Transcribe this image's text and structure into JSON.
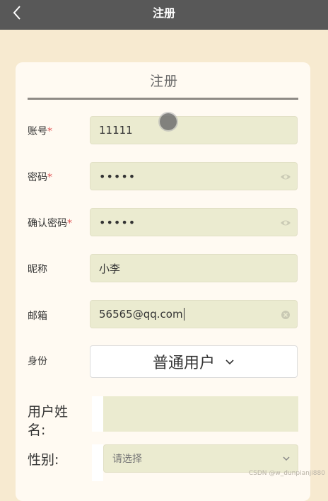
{
  "navbar": {
    "title": "注册"
  },
  "card": {
    "title": "注册"
  },
  "form": {
    "account": {
      "label": "账号",
      "required": "*",
      "value": "11111"
    },
    "password": {
      "label": "密码",
      "required": "*",
      "value": "•••••"
    },
    "confirm_password": {
      "label": "确认密码",
      "required": "*",
      "value": "•••••"
    },
    "nickname": {
      "label": "昵称",
      "value": "小李"
    },
    "email": {
      "label": "邮箱",
      "value": "56565@qq.com"
    },
    "role": {
      "label": "身份",
      "value": "普通用户"
    },
    "real_name": {
      "label_line1": "用户姓",
      "label_line2": "名:",
      "value": ""
    },
    "gender": {
      "label": "性别:",
      "placeholder": "请选择"
    }
  },
  "watermark": "CSDN @w_dunpianji880",
  "colors": {
    "navbar": "#585858",
    "page_bg": "#f7ead0",
    "card_bg": "#fffaf2",
    "input_bg": "#ebebd0",
    "required": "#e05555"
  }
}
